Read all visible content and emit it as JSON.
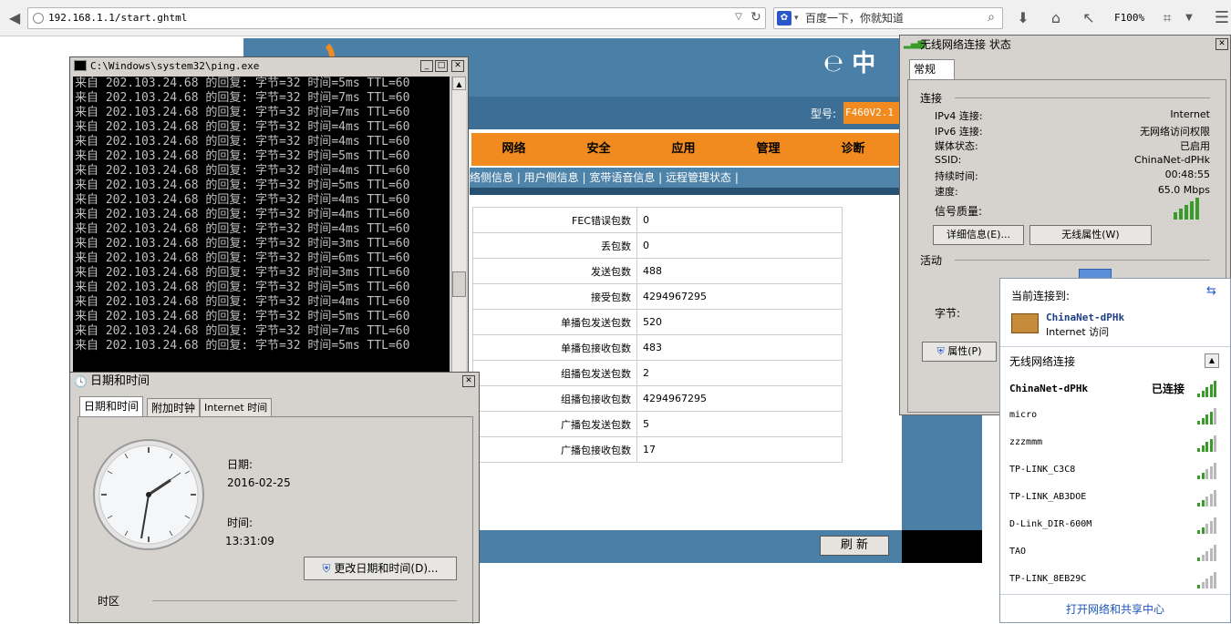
{
  "browser": {
    "url": "192.168.1.1/start.ghtml",
    "search_placeholder": "百度一下，你就知道",
    "zoom": "F100%"
  },
  "router": {
    "model_label": "型号:",
    "model_value": "F460V2.1",
    "nav": [
      "网络",
      "安全",
      "应用",
      "管理",
      "诊断"
    ],
    "subnav": "络侧信息 | 用户侧信息 | 宽带语音信息 | 远程管理状态 |",
    "rows": [
      {
        "label": "FEC错误包数",
        "value": "0"
      },
      {
        "label": "丢包数",
        "value": "0"
      },
      {
        "label": "发送包数",
        "value": "488"
      },
      {
        "label": "接受包数",
        "value": "4294967295"
      },
      {
        "label": "单播包发送包数",
        "value": "520"
      },
      {
        "label": "单播包接收包数",
        "value": "483"
      },
      {
        "label": "组播包发送包数",
        "value": "2"
      },
      {
        "label": "组播包接收包数",
        "value": "4294967295"
      },
      {
        "label": "广播包发送包数",
        "value": "5"
      },
      {
        "label": "广播包接收包数",
        "value": "17"
      }
    ],
    "refresh_label": "刷 新"
  },
  "ping": {
    "title": "C:\\Windows\\system32\\ping.exe",
    "lines": [
      "来自 202.103.24.68 的回复: 字节=32 时间=5ms TTL=60",
      "来自 202.103.24.68 的回复: 字节=32 时间=7ms TTL=60",
      "来自 202.103.24.68 的回复: 字节=32 时间=7ms TTL=60",
      "来自 202.103.24.68 的回复: 字节=32 时间=4ms TTL=60",
      "来自 202.103.24.68 的回复: 字节=32 时间=4ms TTL=60",
      "来自 202.103.24.68 的回复: 字节=32 时间=5ms TTL=60",
      "来自 202.103.24.68 的回复: 字节=32 时间=4ms TTL=60",
      "来自 202.103.24.68 的回复: 字节=32 时间=5ms TTL=60",
      "来自 202.103.24.68 的回复: 字节=32 时间=4ms TTL=60",
      "来自 202.103.24.68 的回复: 字节=32 时间=4ms TTL=60",
      "来自 202.103.24.68 的回复: 字节=32 时间=4ms TTL=60",
      "来自 202.103.24.68 的回复: 字节=32 时间=3ms TTL=60",
      "来自 202.103.24.68 的回复: 字节=32 时间=6ms TTL=60",
      "来自 202.103.24.68 的回复: 字节=32 时间=3ms TTL=60",
      "来自 202.103.24.68 的回复: 字节=32 时间=5ms TTL=60",
      "来自 202.103.24.68 的回复: 字节=32 时间=4ms TTL=60",
      "来自 202.103.24.68 的回复: 字节=32 时间=5ms TTL=60",
      "来自 202.103.24.68 的回复: 字节=32 时间=7ms TTL=60",
      "来自 202.103.24.68 的回复: 字节=32 时间=5ms TTL=60"
    ]
  },
  "datetime": {
    "title": "日期和时间",
    "tabs": [
      "日期和时间",
      "附加时钟",
      "Internet 时间"
    ],
    "date_label": "日期:",
    "date_value": "2016-02-25",
    "time_label": "时间:",
    "time_value": "13:31:09",
    "change_button": "更改日期和时间(D)...",
    "timezone_label": "时区"
  },
  "wireless_status": {
    "title": "无线网络连接 状态",
    "tab": "常规",
    "connection_label": "连接",
    "fields": [
      {
        "k": "IPv4 连接:",
        "v": "Internet"
      },
      {
        "k": "IPv6 连接:",
        "v": "无网络访问权限"
      },
      {
        "k": "媒体状态:",
        "v": "已启用"
      },
      {
        "k": "SSID:",
        "v": "ChinaNet-dPHk"
      },
      {
        "k": "持续时间:",
        "v": "00:48:55"
      },
      {
        "k": "速度:",
        "v": "65.0 Mbps"
      }
    ],
    "signal_label": "信号质量:",
    "details_button": "详细信息(E)...",
    "props_button": "无线属性(W)",
    "activity_label": "活动",
    "bytes_label": "字节:",
    "properties_button": "属性(P)"
  },
  "wifi_flyout": {
    "current_label": "当前连接到:",
    "current_name": "ChinaNet-dPHk",
    "current_access": "Internet 访问",
    "section_label": "无线网络连接",
    "connected_label": "已连接",
    "networks": [
      {
        "name": "ChinaNet-dPHk",
        "strength": 5
      },
      {
        "name": "micro",
        "strength": 4
      },
      {
        "name": "zzzmmm",
        "strength": 4
      },
      {
        "name": "TP-LINK_C3C8",
        "strength": 2
      },
      {
        "name": "TP-LINK_AB3DOE",
        "strength": 2
      },
      {
        "name": "D-Link_DIR-600M",
        "strength": 2
      },
      {
        "name": "TAO",
        "strength": 1
      },
      {
        "name": "TP-LINK_8EB29C",
        "strength": 1
      }
    ],
    "open_center": "打开网络和共享中心"
  }
}
